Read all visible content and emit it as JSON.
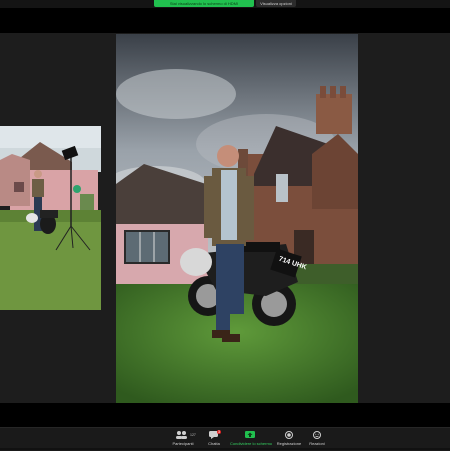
{
  "top_bar": {
    "share_banner": "Stai visualizzando lo schermo di HDMI",
    "view_options": "Visualizza opzioni"
  },
  "toolbar": {
    "participants_label": "Partecipanti",
    "participants_count": "127",
    "chat_label": "Chatta",
    "chat_badge": "3",
    "share_label": "Condividere lo schermo",
    "record_label": "Registrazione",
    "reactions_label": "Reazioni"
  },
  "photo": {
    "license_plate": "714 UHK"
  },
  "colors": {
    "share_green": "#21c04f",
    "toolbar_bg": "#1a1a1a",
    "badge_red": "#e02424"
  }
}
